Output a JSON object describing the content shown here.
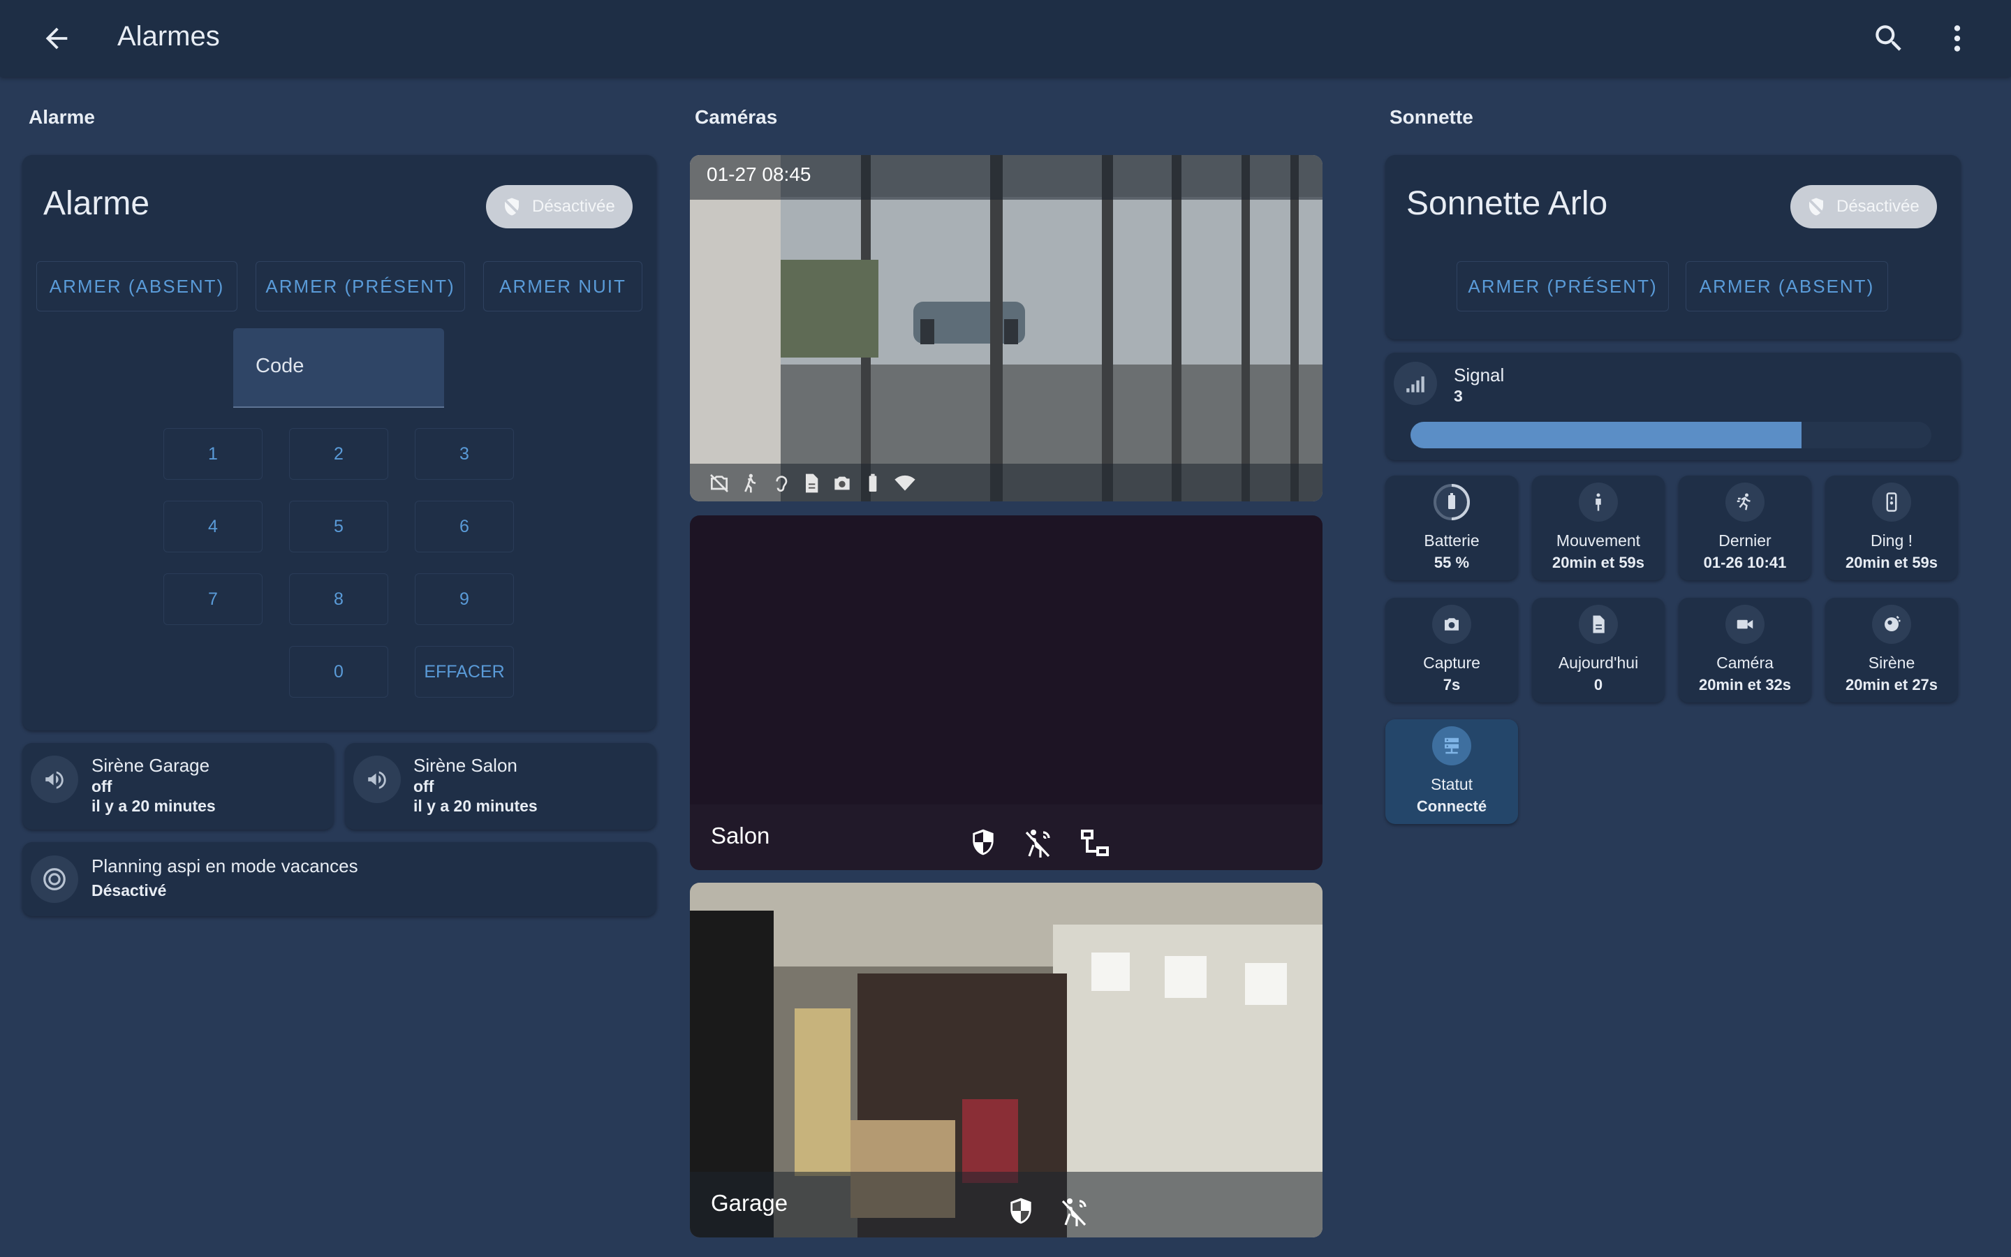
{
  "header": {
    "title": "Alarmes"
  },
  "sections": {
    "alarm": "Alarme",
    "cameras": "Caméras",
    "doorbell": "Sonnette"
  },
  "alarm_panel": {
    "name": "Alarme",
    "state": "Désactivée",
    "actions": [
      "ARMER (ABSENT)",
      "ARMER (PRÉSENT)",
      "ARMER NUIT"
    ],
    "code_label": "Code",
    "keys": [
      "1",
      "2",
      "3",
      "4",
      "5",
      "6",
      "7",
      "8",
      "9",
      "0"
    ],
    "clear_label": "EFFACER"
  },
  "sirens": [
    {
      "name": "Sirène Garage",
      "state": "off",
      "changed": "il y a 20 minutes",
      "icon": "bullhorn-icon"
    },
    {
      "name": "Sirène Salon",
      "state": "off",
      "changed": "il y a 20 minutes",
      "icon": "bullhorn-icon"
    }
  ],
  "planning": {
    "name": "Planning aspi en mode vacances",
    "state": "Désactivé",
    "icon": "robot-vacuum-icon"
  },
  "cameras": [
    {
      "timestamp": "01-27 08:45",
      "status_icons": [
        "camera-off-icon",
        "walk-icon",
        "ear-icon",
        "file-icon",
        "camera-icon",
        "battery-icon",
        "wifi-icon"
      ]
    },
    {
      "label": "Salon",
      "icons": [
        "shield-icon",
        "motion-sensor-icon",
        "lan-icon"
      ]
    },
    {
      "label": "Garage",
      "icons": [
        "shield-icon",
        "motion-sensor-icon"
      ]
    }
  ],
  "doorbell": {
    "name": "Sonnette Arlo",
    "state": "Désactivée",
    "actions": [
      "ARMER (PRÉSENT)",
      "ARMER (ABSENT)"
    ],
    "signal": {
      "label": "Signal",
      "value": "3",
      "level_fraction": 0.75
    },
    "tiles": [
      {
        "name": "Batterie",
        "value": "55 %",
        "icon": "battery-icon"
      },
      {
        "name": "Mouvement",
        "value": "20min et 59s",
        "icon": "human-icon"
      },
      {
        "name": "Dernier",
        "value": "01-26 10:41",
        "icon": "run-icon"
      },
      {
        "name": "Ding !",
        "value": "20min et 59s",
        "icon": "doorbell-icon"
      },
      {
        "name": "Capture",
        "value": "7s",
        "icon": "camera-icon"
      },
      {
        "name": "Aujourd'hui",
        "value": "0",
        "icon": "file-icon"
      },
      {
        "name": "Caméra",
        "value": "20min et 32s",
        "icon": "video-icon"
      },
      {
        "name": "Sirène",
        "value": "20min et 27s",
        "icon": "alarm-light-icon"
      },
      {
        "name": "Statut",
        "value": "Connecté",
        "icon": "server-network-icon"
      }
    ]
  },
  "colors": {
    "background": "#283a57",
    "card": "#1f2f47",
    "accent": "#5a9bd8",
    "signal_bar": "#5b8ec6"
  }
}
